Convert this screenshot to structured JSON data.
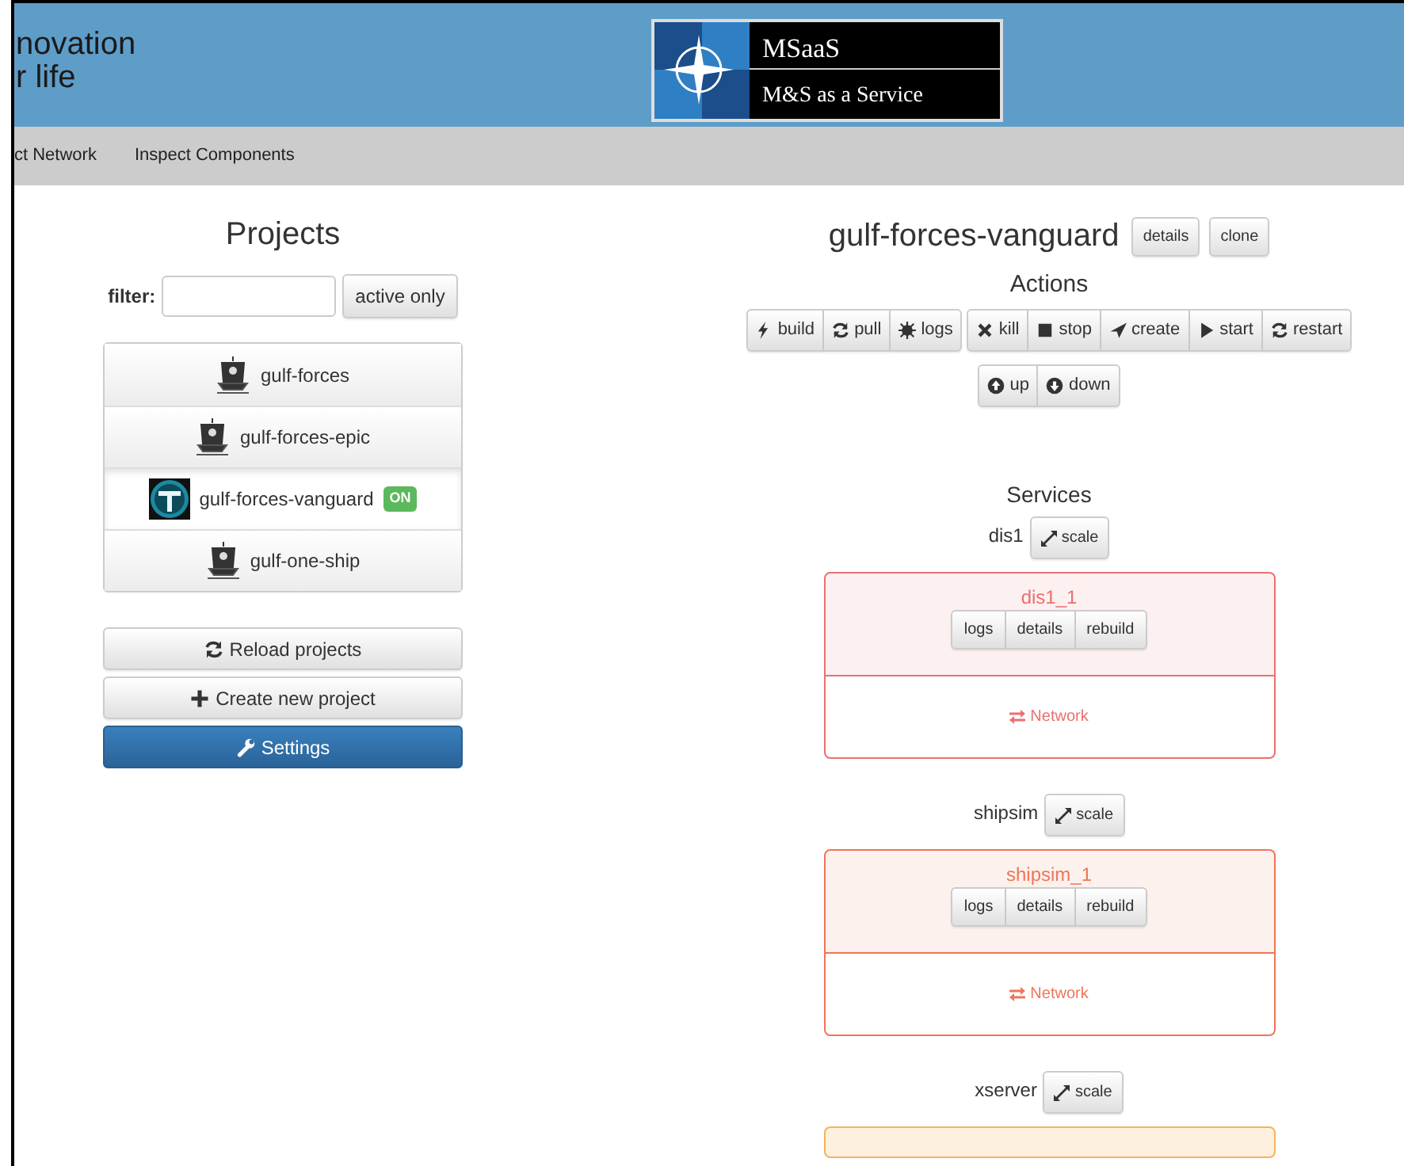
{
  "header": {
    "tagline_lines": [
      "novation",
      "r life"
    ],
    "logo": {
      "title": "MSaaS",
      "subtitle": "M&S as a Service"
    }
  },
  "nav": [
    {
      "label": "ct Network"
    },
    {
      "label": "Inspect Components"
    }
  ],
  "projects": {
    "title": "Projects",
    "filter_label": "filter:",
    "filter_button": "active only",
    "items": [
      {
        "name": "gulf-forces",
        "kind": "ship",
        "selected": false
      },
      {
        "name": "gulf-forces-epic",
        "kind": "ship",
        "selected": false
      },
      {
        "name": "gulf-forces-vanguard",
        "kind": "logo",
        "selected": true,
        "badge": "ON"
      },
      {
        "name": "gulf-one-ship",
        "kind": "ship",
        "selected": false
      }
    ],
    "buttons": [
      {
        "label": "Reload projects",
        "kind": "reload"
      },
      {
        "label": "Create new project",
        "kind": "create"
      },
      {
        "label": "Settings",
        "kind": "settings"
      }
    ]
  },
  "detail": {
    "title": "gulf-forces-vanguard",
    "buttons": [
      "details",
      "clone"
    ],
    "actions_title": "Actions",
    "action_groups": [
      [
        {
          "label": "build",
          "kind": "build"
        },
        {
          "label": "pull",
          "kind": "pull"
        },
        {
          "label": "logs",
          "kind": "logs"
        }
      ],
      [
        {
          "label": "kill",
          "kind": "kill"
        },
        {
          "label": "stop",
          "kind": "stop"
        },
        {
          "label": "create",
          "kind": "create"
        },
        {
          "label": "start",
          "kind": "start"
        },
        {
          "label": "restart",
          "kind": "restart"
        }
      ],
      [
        {
          "label": "up",
          "kind": "up"
        },
        {
          "label": "down",
          "kind": "down"
        }
      ]
    ],
    "services_title": "Services",
    "services": [
      {
        "name": "dis1",
        "scale": "scale",
        "color": "#ec6f6f",
        "containers": [
          {
            "name": "dis1_1",
            "buttons": [
              "logs",
              "details",
              "rebuild"
            ],
            "network": "Network"
          }
        ]
      },
      {
        "name": "shipsim",
        "scale": "scale",
        "color": "#ef7558",
        "containers": [
          {
            "name": "shipsim_1",
            "buttons": [
              "logs",
              "details",
              "rebuild"
            ],
            "network": "Network"
          }
        ]
      },
      {
        "name": "xserver",
        "scale": "scale",
        "color": "#f5b35c"
      }
    ]
  }
}
